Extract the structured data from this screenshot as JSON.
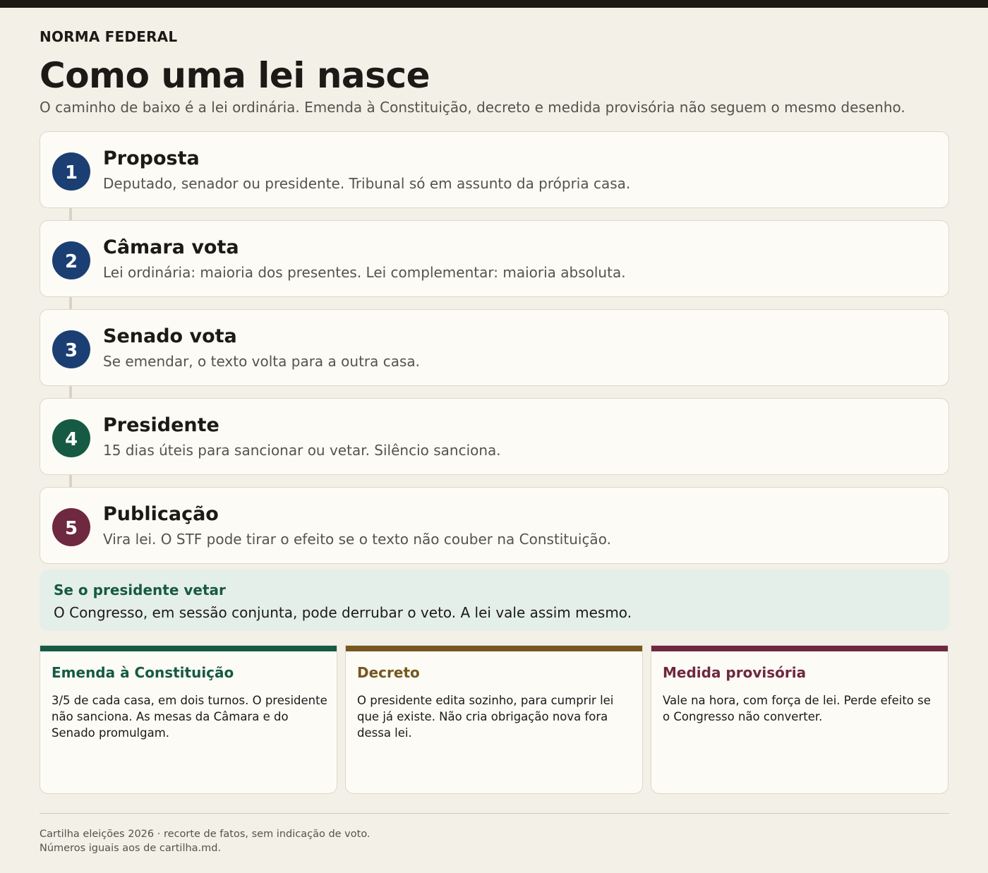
{
  "header": {
    "kicker": "NORMA FEDERAL",
    "title": "Como uma lei nasce",
    "subtitle": "O caminho de baixo é a lei ordinária. Emenda à Constituição, decreto e medida provisória não seguem o mesmo desenho."
  },
  "colors": {
    "background": "#f3f0e7",
    "blue": "#1b3f73",
    "green": "#165a43",
    "wine": "#6e2840",
    "olive": "#75571f",
    "callout_bg": "#e5efe9"
  },
  "steps": [
    {
      "number": "1",
      "title": "Proposta",
      "description": "Deputado, senador ou presidente. Tribunal só em assunto da própria casa.",
      "color": "#1b3f73"
    },
    {
      "number": "2",
      "title": "Câmara vota",
      "description": "Lei ordinária: maioria dos presentes. Lei complementar: maioria absoluta.",
      "color": "#1b3f73"
    },
    {
      "number": "3",
      "title": "Senado vota",
      "description": "Se emendar, o texto volta para a outra casa.",
      "color": "#1b3f73"
    },
    {
      "number": "4",
      "title": "Presidente",
      "description": "15 dias úteis para sancionar ou vetar. Silêncio sanciona.",
      "color": "#165a43"
    },
    {
      "number": "5",
      "title": "Publicação",
      "description": "Vira lei. O STF pode tirar o efeito se o texto não couber na Constituição.",
      "color": "#6e2840"
    }
  ],
  "callout": {
    "title": "Se o presidente vetar",
    "text": "O Congresso, em sessão conjunta, pode derrubar o veto. A lei vale assim mesmo."
  },
  "cards": [
    {
      "title": "Emenda à Constituição",
      "text": "3/5 de cada casa, em dois turnos. O presidente não sanciona. As mesas da Câmara e do Senado promulgam.",
      "color": "#165a43"
    },
    {
      "title": "Decreto",
      "text": "O presidente edita sozinho, para cumprir lei que já existe. Não cria obrigação nova fora dessa lei.",
      "color": "#75571f"
    },
    {
      "title": "Medida provisória",
      "text": "Vale na hora, com força de lei. Perde efeito se o Congresso não converter.",
      "color": "#6e2840"
    }
  ],
  "footer": {
    "line1": "Cartilha eleições 2026 · recorte de fatos, sem indicação de voto.",
    "line2": "Números iguais aos de cartilha.md."
  }
}
